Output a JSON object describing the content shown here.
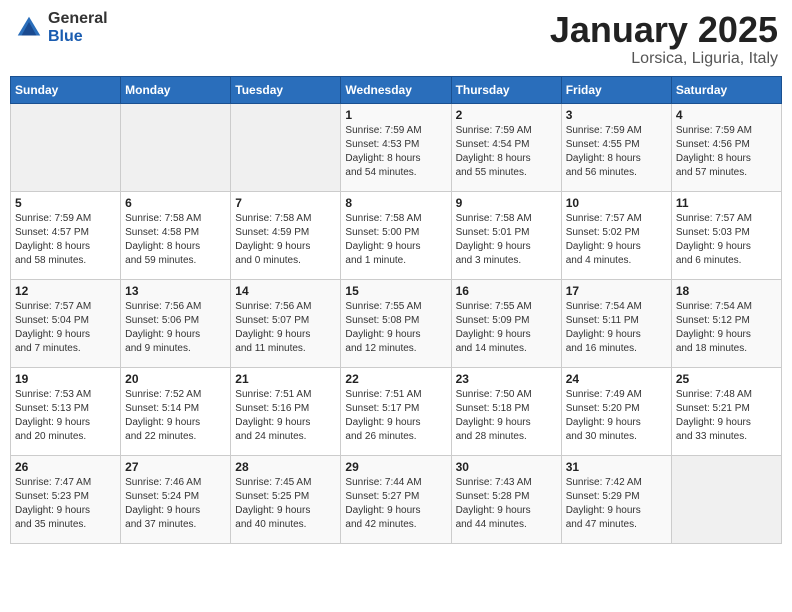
{
  "header": {
    "logo_general": "General",
    "logo_blue": "Blue",
    "month": "January 2025",
    "location": "Lorsica, Liguria, Italy"
  },
  "weekdays": [
    "Sunday",
    "Monday",
    "Tuesday",
    "Wednesday",
    "Thursday",
    "Friday",
    "Saturday"
  ],
  "weeks": [
    [
      {
        "day": "",
        "info": ""
      },
      {
        "day": "",
        "info": ""
      },
      {
        "day": "",
        "info": ""
      },
      {
        "day": "1",
        "info": "Sunrise: 7:59 AM\nSunset: 4:53 PM\nDaylight: 8 hours\nand 54 minutes."
      },
      {
        "day": "2",
        "info": "Sunrise: 7:59 AM\nSunset: 4:54 PM\nDaylight: 8 hours\nand 55 minutes."
      },
      {
        "day": "3",
        "info": "Sunrise: 7:59 AM\nSunset: 4:55 PM\nDaylight: 8 hours\nand 56 minutes."
      },
      {
        "day": "4",
        "info": "Sunrise: 7:59 AM\nSunset: 4:56 PM\nDaylight: 8 hours\nand 57 minutes."
      }
    ],
    [
      {
        "day": "5",
        "info": "Sunrise: 7:59 AM\nSunset: 4:57 PM\nDaylight: 8 hours\nand 58 minutes."
      },
      {
        "day": "6",
        "info": "Sunrise: 7:58 AM\nSunset: 4:58 PM\nDaylight: 8 hours\nand 59 minutes."
      },
      {
        "day": "7",
        "info": "Sunrise: 7:58 AM\nSunset: 4:59 PM\nDaylight: 9 hours\nand 0 minutes."
      },
      {
        "day": "8",
        "info": "Sunrise: 7:58 AM\nSunset: 5:00 PM\nDaylight: 9 hours\nand 1 minute."
      },
      {
        "day": "9",
        "info": "Sunrise: 7:58 AM\nSunset: 5:01 PM\nDaylight: 9 hours\nand 3 minutes."
      },
      {
        "day": "10",
        "info": "Sunrise: 7:57 AM\nSunset: 5:02 PM\nDaylight: 9 hours\nand 4 minutes."
      },
      {
        "day": "11",
        "info": "Sunrise: 7:57 AM\nSunset: 5:03 PM\nDaylight: 9 hours\nand 6 minutes."
      }
    ],
    [
      {
        "day": "12",
        "info": "Sunrise: 7:57 AM\nSunset: 5:04 PM\nDaylight: 9 hours\nand 7 minutes."
      },
      {
        "day": "13",
        "info": "Sunrise: 7:56 AM\nSunset: 5:06 PM\nDaylight: 9 hours\nand 9 minutes."
      },
      {
        "day": "14",
        "info": "Sunrise: 7:56 AM\nSunset: 5:07 PM\nDaylight: 9 hours\nand 11 minutes."
      },
      {
        "day": "15",
        "info": "Sunrise: 7:55 AM\nSunset: 5:08 PM\nDaylight: 9 hours\nand 12 minutes."
      },
      {
        "day": "16",
        "info": "Sunrise: 7:55 AM\nSunset: 5:09 PM\nDaylight: 9 hours\nand 14 minutes."
      },
      {
        "day": "17",
        "info": "Sunrise: 7:54 AM\nSunset: 5:11 PM\nDaylight: 9 hours\nand 16 minutes."
      },
      {
        "day": "18",
        "info": "Sunrise: 7:54 AM\nSunset: 5:12 PM\nDaylight: 9 hours\nand 18 minutes."
      }
    ],
    [
      {
        "day": "19",
        "info": "Sunrise: 7:53 AM\nSunset: 5:13 PM\nDaylight: 9 hours\nand 20 minutes."
      },
      {
        "day": "20",
        "info": "Sunrise: 7:52 AM\nSunset: 5:14 PM\nDaylight: 9 hours\nand 22 minutes."
      },
      {
        "day": "21",
        "info": "Sunrise: 7:51 AM\nSunset: 5:16 PM\nDaylight: 9 hours\nand 24 minutes."
      },
      {
        "day": "22",
        "info": "Sunrise: 7:51 AM\nSunset: 5:17 PM\nDaylight: 9 hours\nand 26 minutes."
      },
      {
        "day": "23",
        "info": "Sunrise: 7:50 AM\nSunset: 5:18 PM\nDaylight: 9 hours\nand 28 minutes."
      },
      {
        "day": "24",
        "info": "Sunrise: 7:49 AM\nSunset: 5:20 PM\nDaylight: 9 hours\nand 30 minutes."
      },
      {
        "day": "25",
        "info": "Sunrise: 7:48 AM\nSunset: 5:21 PM\nDaylight: 9 hours\nand 33 minutes."
      }
    ],
    [
      {
        "day": "26",
        "info": "Sunrise: 7:47 AM\nSunset: 5:23 PM\nDaylight: 9 hours\nand 35 minutes."
      },
      {
        "day": "27",
        "info": "Sunrise: 7:46 AM\nSunset: 5:24 PM\nDaylight: 9 hours\nand 37 minutes."
      },
      {
        "day": "28",
        "info": "Sunrise: 7:45 AM\nSunset: 5:25 PM\nDaylight: 9 hours\nand 40 minutes."
      },
      {
        "day": "29",
        "info": "Sunrise: 7:44 AM\nSunset: 5:27 PM\nDaylight: 9 hours\nand 42 minutes."
      },
      {
        "day": "30",
        "info": "Sunrise: 7:43 AM\nSunset: 5:28 PM\nDaylight: 9 hours\nand 44 minutes."
      },
      {
        "day": "31",
        "info": "Sunrise: 7:42 AM\nSunset: 5:29 PM\nDaylight: 9 hours\nand 47 minutes."
      },
      {
        "day": "",
        "info": ""
      }
    ]
  ]
}
